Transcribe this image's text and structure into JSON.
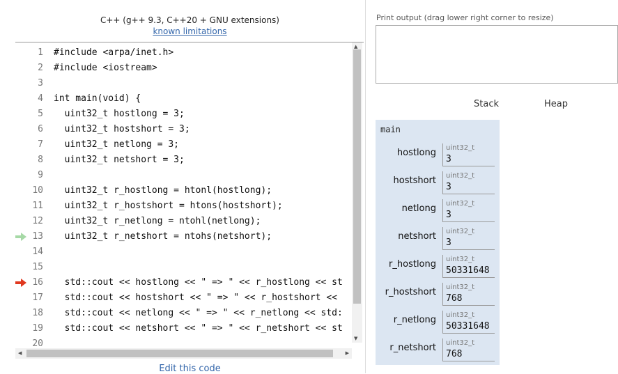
{
  "header": {
    "title": "C++ (g++ 9.3, C++20 + GNU extensions)",
    "limitations_link": "known limitations"
  },
  "code": {
    "lines": [
      {
        "no": "1",
        "text": "#include <arpa/inet.h>"
      },
      {
        "no": "2",
        "text": "#include <iostream>"
      },
      {
        "no": "3",
        "text": ""
      },
      {
        "no": "4",
        "text": "int main(void) {"
      },
      {
        "no": "5",
        "text": "  uint32_t hostlong = 3;"
      },
      {
        "no": "6",
        "text": "  uint32_t hostshort = 3;"
      },
      {
        "no": "7",
        "text": "  uint32_t netlong = 3;"
      },
      {
        "no": "8",
        "text": "  uint32_t netshort = 3;"
      },
      {
        "no": "9",
        "text": ""
      },
      {
        "no": "10",
        "text": "  uint32_t r_hostlong = htonl(hostlong);"
      },
      {
        "no": "11",
        "text": "  uint32_t r_hostshort = htons(hostshort);"
      },
      {
        "no": "12",
        "text": "  uint32_t r_netlong = ntohl(netlong);"
      },
      {
        "no": "13",
        "text": "  uint32_t r_netshort = ntohs(netshort);"
      },
      {
        "no": "14",
        "text": ""
      },
      {
        "no": "15",
        "text": ""
      },
      {
        "no": "16",
        "text": "  std::cout << hostlong << \" => \" << r_hostlong << st"
      },
      {
        "no": "17",
        "text": "  std::cout << hostshort << \" => \" << r_hostshort <<"
      },
      {
        "no": "18",
        "text": "  std::cout << netlong << \" => \" << r_netlong << std:"
      },
      {
        "no": "19",
        "text": "  std::cout << netshort << \" => \" << r_netshort << st"
      },
      {
        "no": "20",
        "text": ""
      }
    ],
    "just_executed_line": "13",
    "next_line": "16",
    "colors": {
      "just_executed_arrow": "#a6d9a6",
      "next_arrow": "#e0381f"
    }
  },
  "edit_link": "Edit this code",
  "output": {
    "label": "Print output (drag lower right corner to resize)",
    "text": ""
  },
  "viz": {
    "stack_label": "Stack",
    "heap_label": "Heap",
    "frame": {
      "name": "main",
      "vars": [
        {
          "name": "hostlong",
          "type": "uint32_t",
          "value": "3"
        },
        {
          "name": "hostshort",
          "type": "uint32_t",
          "value": "3"
        },
        {
          "name": "netlong",
          "type": "uint32_t",
          "value": "3"
        },
        {
          "name": "netshort",
          "type": "uint32_t",
          "value": "3"
        },
        {
          "name": "r_hostlong",
          "type": "uint32_t",
          "value": "50331648"
        },
        {
          "name": "r_hostshort",
          "type": "uint32_t",
          "value": "768"
        },
        {
          "name": "r_netlong",
          "type": "uint32_t",
          "value": "50331648"
        },
        {
          "name": "r_netshort",
          "type": "uint32_t",
          "value": "768"
        }
      ]
    }
  }
}
